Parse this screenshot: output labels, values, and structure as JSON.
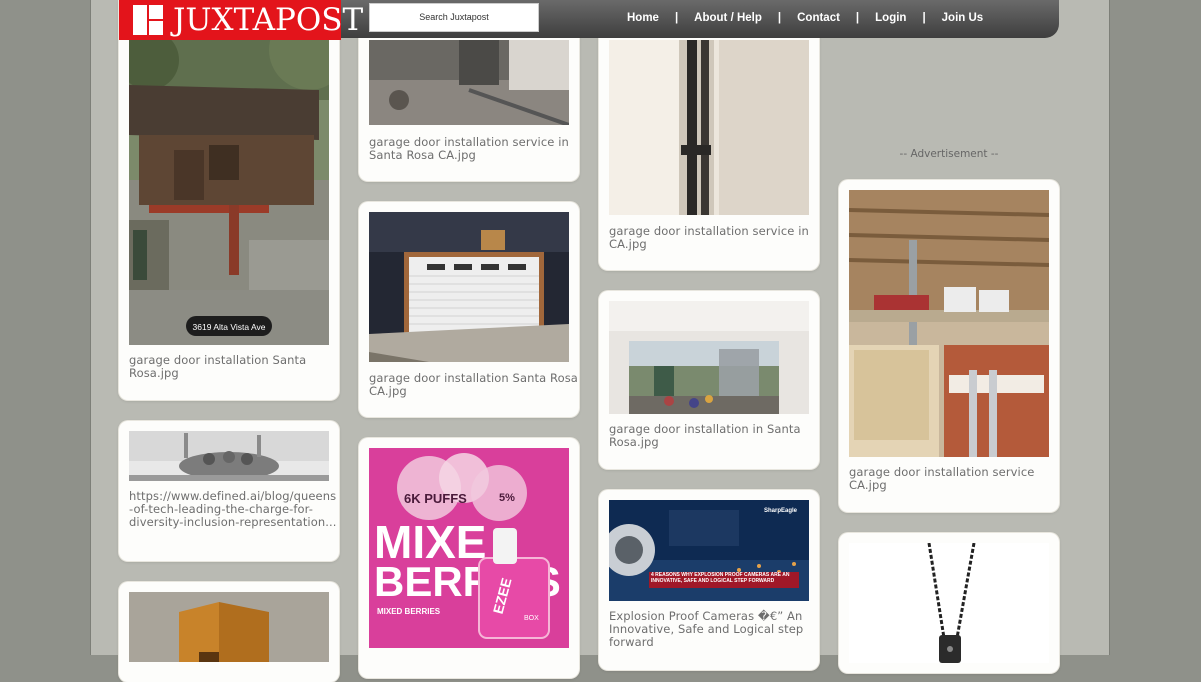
{
  "site": {
    "logo_text": "JUXTAPOST",
    "search_placeholder": "Search Juxtapost"
  },
  "nav": {
    "home": "Home",
    "about": "About / Help",
    "contact": "Contact",
    "login": "Login",
    "join": "Join Us",
    "separator": "|"
  },
  "ad_label": "-- Advertisement --",
  "cards": {
    "c1": {
      "caption": "garage door installation Santa Rosa.jpg",
      "image_text": "3619 Alta Vista Ave"
    },
    "c2": {
      "caption": "https://www.defined.ai/blog/queens-of-tech-leading-the-charge-for-diversity-inclusion-representation..."
    },
    "c4": {
      "caption": "garage door installation service in Santa Rosa CA.jpg"
    },
    "c5": {
      "caption": "garage door installation Santa Rosa CA.jpg"
    },
    "c6": {
      "text_puffs": "6K PUFFS",
      "text_pct": "5%",
      "text_big1": "MIXE",
      "text_big2": "BERRIES",
      "text_small": "MIXED BERRIES",
      "text_brand": "EZEE",
      "text_box": "BOX"
    },
    "c7": {
      "caption": "garage door installation service in CA.jpg"
    },
    "c8": {
      "caption": "garage door installation in Santa Rosa.jpg"
    },
    "c9": {
      "caption": "Explosion Proof Cameras �€” An Innovative, Safe and Logical step forward",
      "image_banner": "4 REASONS WHY EXPLOSION PROOF CAMERAS ARE AN INNOVATIVE, SAFE AND LOGICAL STEP FORWARD",
      "brand": "SharpEagle"
    },
    "c10": {
      "caption": "garage door installation service CA.jpg"
    }
  }
}
